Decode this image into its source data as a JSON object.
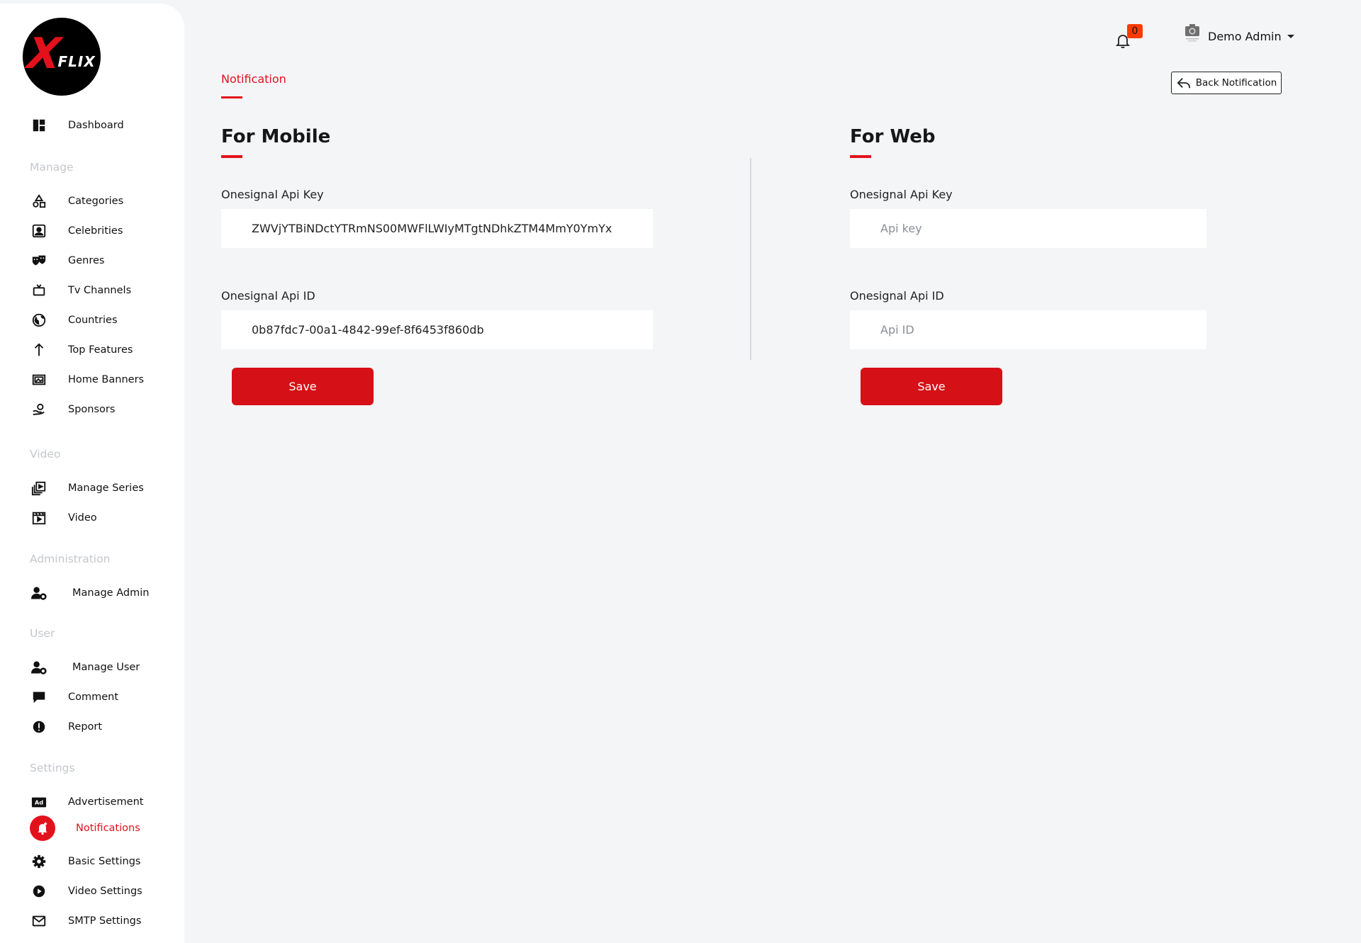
{
  "brand": {
    "logo_letter": "X",
    "logo_word": "FLIX"
  },
  "sidebar": {
    "dashboard": "Dashboard",
    "sections": {
      "manage": "Manage",
      "video": "Video",
      "administration": "Administration",
      "user": "User",
      "settings": "Settings"
    },
    "items": {
      "categories": "Categories",
      "celebrities": "Celebrities",
      "genres": "Genres",
      "tv_channels": "Tv Channels",
      "countries": "Countries",
      "top_features": "Top Features",
      "home_banners": "Home Banners",
      "sponsors": "Sponsors",
      "manage_series": "Manage Series",
      "video": "Video",
      "manage_admin": "Manage Admin",
      "manage_user": "Manage User",
      "comment": "Comment",
      "report": "Report",
      "advertisement": "Advertisement",
      "notifications": "Notifications",
      "basic_settings": "Basic Settings",
      "video_settings": "Video Settings",
      "smtp_settings": "SMTP Settings"
    },
    "active": "notifications",
    "accent": "#e3111b"
  },
  "header": {
    "notification_count": "0",
    "user_name": "Demo Admin"
  },
  "page": {
    "tab_label": "Notification",
    "back_button": "Back Notification"
  },
  "mobile": {
    "title": "For Mobile",
    "api_key_label": "Onesignal Api Key",
    "api_key_value": "ZWVjYTBiNDctYTRmNS00MWFlLWIyMTgtNDhkZTM4MmY0YmYx",
    "api_id_label": "Onesignal Api ID",
    "api_id_value": "0b87fdc7-00a1-4842-99ef-8f6453f860db",
    "save": "Save"
  },
  "web": {
    "title": "For Web",
    "api_key_label": "Onesignal Api Key",
    "api_key_placeholder": "Api key",
    "api_id_label": "Onesignal Api ID",
    "api_id_placeholder": "Api ID",
    "save": "Save"
  }
}
